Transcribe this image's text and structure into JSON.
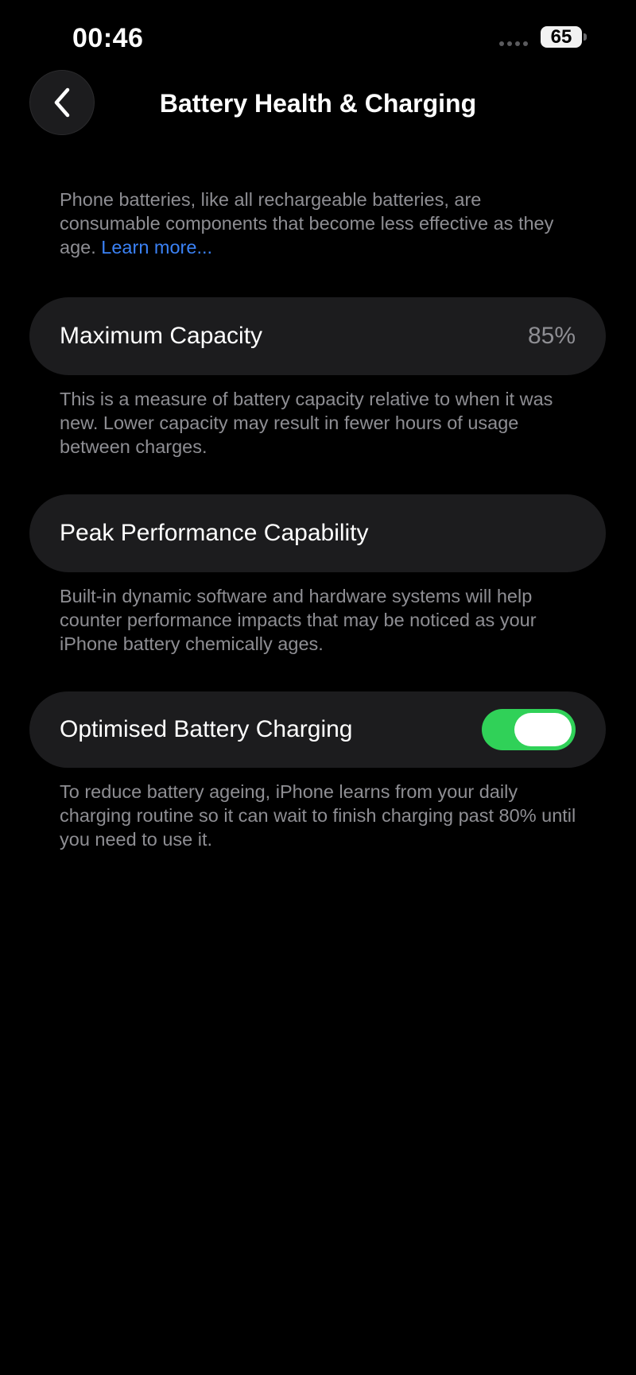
{
  "status_bar": {
    "time": "00:46",
    "battery_level": "65"
  },
  "nav": {
    "title": "Battery Health & Charging",
    "back_icon": "chevron-left-icon"
  },
  "intro": {
    "text": "Phone batteries, like all rechargeable batteries, are consumable components that become less effective as they age.",
    "link_label": "Learn more..."
  },
  "max_capacity": {
    "label": "Maximum Capacity",
    "value": "85%",
    "footnote": "This is a measure of battery capacity relative to when it was new. Lower capacity may result in fewer hours of usage between charges."
  },
  "peak_performance": {
    "label": "Peak Performance Capability",
    "footnote": "Built-in dynamic software and hardware systems will help counter performance impacts that may be noticed as your iPhone battery chemically ages."
  },
  "optimised_charging": {
    "label": "Optimised Battery Charging",
    "enabled": true,
    "footnote": "To reduce battery ageing, iPhone learns from your daily charging routine so it can wait to finish charging past 80% until you need to use it."
  },
  "colors": {
    "background": "#000000",
    "card": "#1c1c1e",
    "secondary_text": "#8e8e93",
    "link": "#3b82f6",
    "toggle_on": "#30d158"
  }
}
